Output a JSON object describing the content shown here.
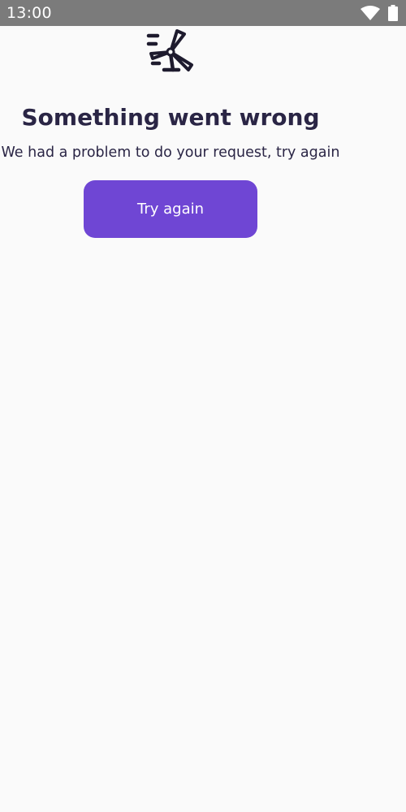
{
  "status_bar": {
    "time": "13:00",
    "icons": [
      "wifi-icon",
      "battery-icon"
    ]
  },
  "error": {
    "illustration_icon": "windmill-error-icon",
    "title": "Something went wrong",
    "message": "We had a problem to do your request, try again",
    "retry_label": "Try again"
  },
  "colors": {
    "status_bar": "#7b7b7b",
    "background": "#fafafa",
    "text": "#2a2545",
    "accent": "#6f46d4",
    "icon": "#1e1b2e"
  }
}
